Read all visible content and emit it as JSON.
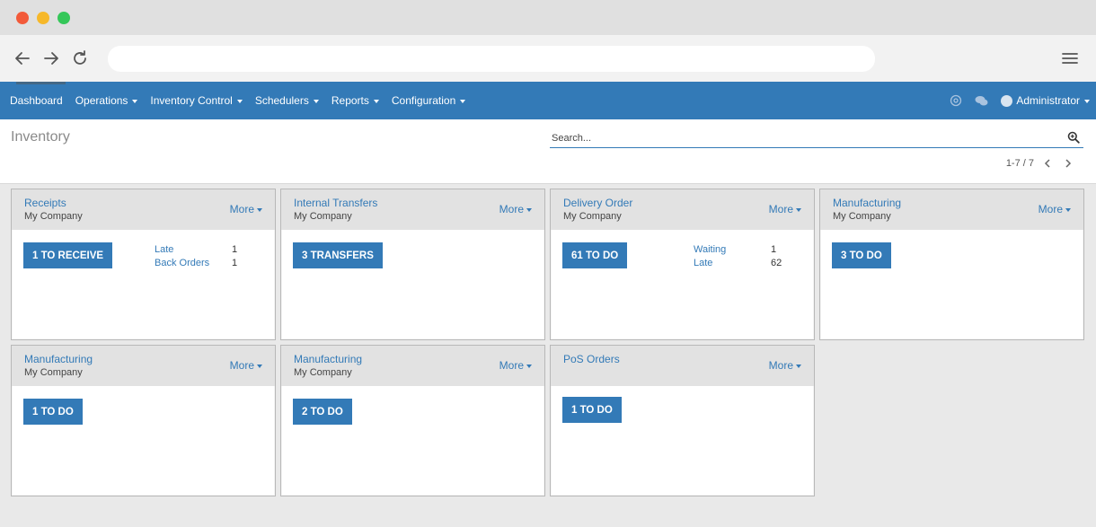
{
  "nav": {
    "items": [
      {
        "label": "Dashboard",
        "caret": false
      },
      {
        "label": "Operations",
        "caret": true
      },
      {
        "label": "Inventory Control",
        "caret": true
      },
      {
        "label": "Schedulers",
        "caret": true
      },
      {
        "label": "Reports",
        "caret": true
      },
      {
        "label": "Configuration",
        "caret": true
      }
    ],
    "user": "Administrator",
    "accent": "#337ab7"
  },
  "control": {
    "title": "Inventory",
    "search_placeholder": "Search...",
    "pager": "1-7 / 7"
  },
  "cards": [
    {
      "name": "Receipts",
      "company": "My Company",
      "more": "More",
      "button": "1 TO RECEIVE",
      "stats": [
        {
          "label": "Late",
          "value": "1"
        },
        {
          "label": "Back Orders",
          "value": "1"
        }
      ]
    },
    {
      "name": "Internal Transfers",
      "company": "My Company",
      "more": "More",
      "button": "3  TRANSFERS",
      "stats": []
    },
    {
      "name": "Delivery Order",
      "company": "My Company",
      "more": "More",
      "button": "61 TO DO",
      "stats": [
        {
          "label": "Waiting",
          "value": "1"
        },
        {
          "label": "Late",
          "value": "62"
        }
      ]
    },
    {
      "name": "Manufacturing",
      "company": "My Company",
      "more": "More",
      "button": "3 TO DO",
      "stats": []
    },
    {
      "name": "Manufacturing",
      "company": "My Company",
      "more": "More",
      "button": "1 TO DO",
      "stats": []
    },
    {
      "name": "Manufacturing",
      "company": "My Company",
      "more": "More",
      "button": "2 TO DO",
      "stats": []
    },
    {
      "name": "PoS Orders",
      "company": "",
      "more": "More",
      "button": "1 TO DO",
      "stats": []
    }
  ]
}
